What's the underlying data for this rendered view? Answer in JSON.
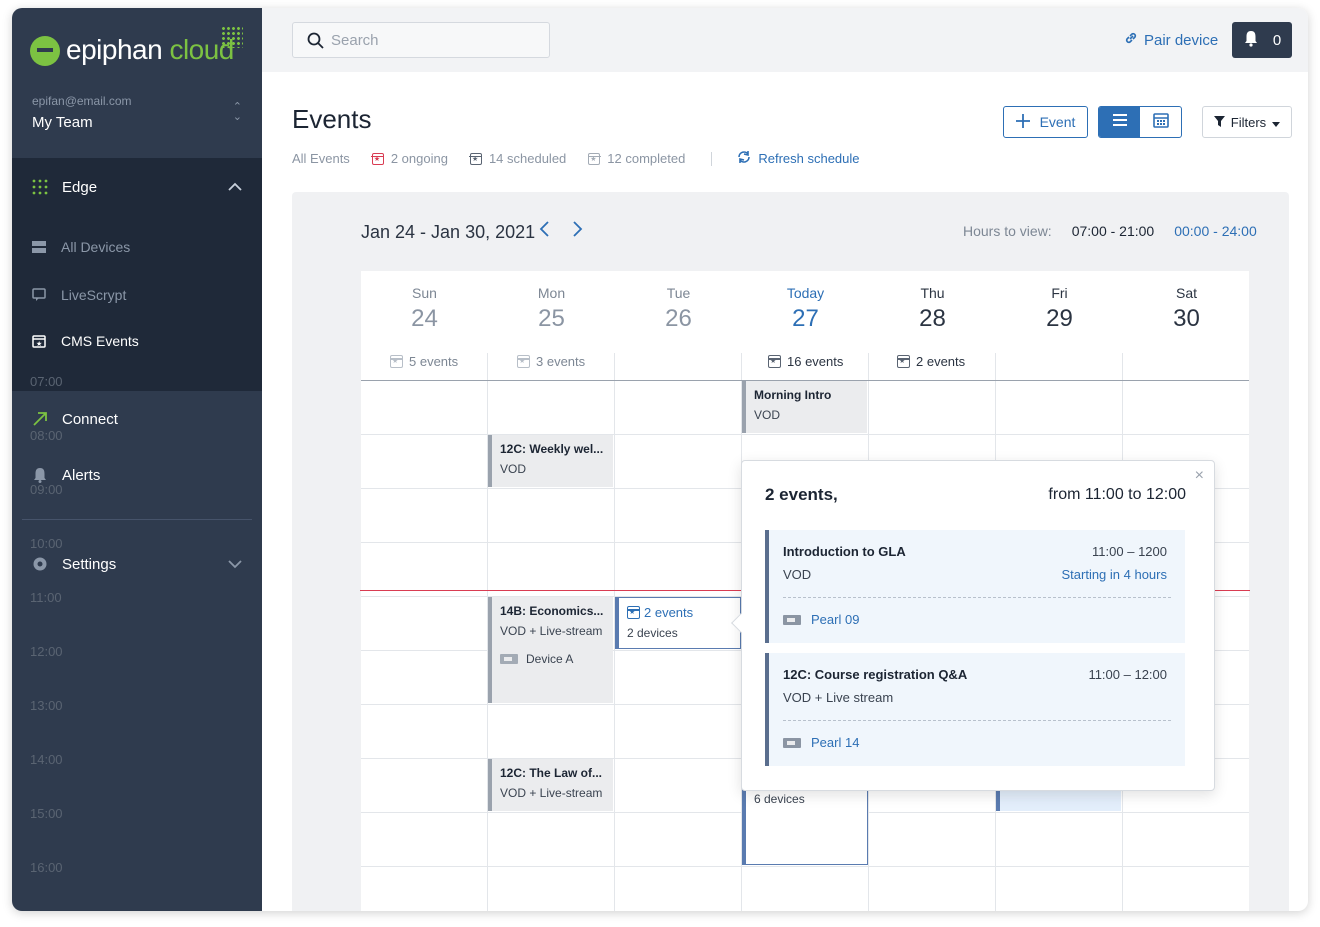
{
  "brand": {
    "word": "epiphan",
    "suffix": "cloud",
    "accent": "#7cc242"
  },
  "account": {
    "email": "epifan@email.com",
    "team": "My Team"
  },
  "sidebar": {
    "edge": {
      "label": "Edge",
      "items": [
        {
          "label": "All Devices",
          "icon": "server-icon"
        },
        {
          "label": "LiveScrypt",
          "icon": "caption-icon"
        },
        {
          "label": "CMS Events",
          "icon": "calendar-icon",
          "active": true
        }
      ]
    },
    "connect": "Connect",
    "alerts": "Alerts",
    "settings": "Settings"
  },
  "topbar": {
    "search_placeholder": "Search",
    "pair_device": "Pair device",
    "notifications": "0"
  },
  "page": {
    "title": "Events",
    "filters": {
      "all": "All Events",
      "ongoing": "2 ongoing",
      "scheduled": "14 scheduled",
      "completed": "12 completed",
      "refresh": "Refresh schedule"
    },
    "add_event": "Event",
    "filters_button": "Filters"
  },
  "calendar": {
    "range": "Jan 24 - Jan 30, 2021",
    "hours_label": "Hours to view:",
    "hours_options": [
      "07:00 - 21:00",
      "00:00 - 24:00"
    ],
    "days": [
      {
        "name": "Sun",
        "date": "24",
        "count": "5 events"
      },
      {
        "name": "Mon",
        "date": "25",
        "count": "3 events"
      },
      {
        "name": "Tue",
        "date": "26",
        "count": ""
      },
      {
        "name": "Today",
        "date": "27",
        "count": "16 events"
      },
      {
        "name": "Thu",
        "date": "28",
        "count": "2 events"
      },
      {
        "name": "Fri",
        "date": "29",
        "count": ""
      },
      {
        "name": "Sat",
        "date": "30",
        "count": ""
      }
    ],
    "times": [
      "07:00",
      "08:00",
      "09:00",
      "10:00",
      "11:00",
      "12:00",
      "13:00",
      "14:00",
      "15:00",
      "16:00"
    ],
    "events": [
      {
        "title": "Morning Intro",
        "sub": "VOD"
      },
      {
        "title": "12C: Weekly wel...",
        "sub": "VOD"
      },
      {
        "title": "14B: Economics...",
        "sub": "VOD + Live-stream",
        "device": "Device A"
      },
      {
        "title": "2 events",
        "sub": "2 devices"
      },
      {
        "title": "12C: The Law of...",
        "sub": "VOD + Live-stream"
      },
      {
        "title": "",
        "sub": "6 devices"
      }
    ]
  },
  "popup": {
    "heading": "2 events,",
    "range": "from 11:00 to 12:00",
    "items": [
      {
        "name": "Introduction to GLA",
        "time": "11:00 – 1200",
        "type": "VOD",
        "status": "Starting in 4 hours",
        "device": "Pearl 09"
      },
      {
        "name": "12C: Course registration Q&A",
        "time": "11:00 – 12:00",
        "type": "VOD + Live stream",
        "status": "",
        "device": "Pearl 14"
      }
    ]
  }
}
